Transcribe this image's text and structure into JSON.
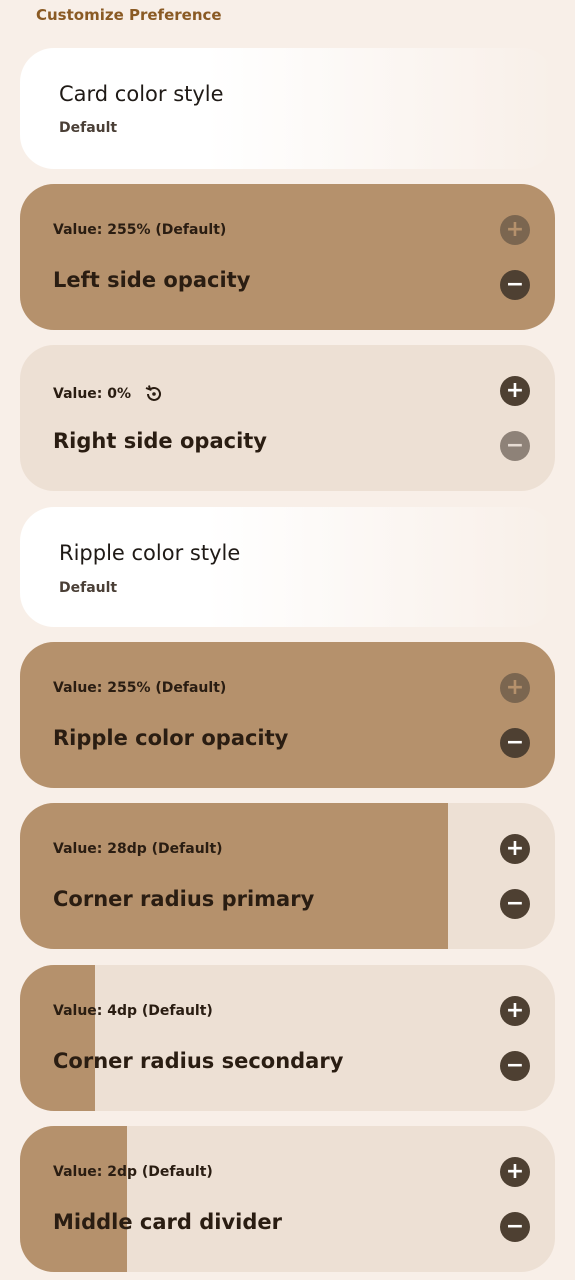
{
  "section_title": "Customize Preference",
  "card_color_style": {
    "title": "Card color style",
    "subtitle": "Default"
  },
  "left_opacity": {
    "value": "Value: 255% (Default)",
    "label": "Left side opacity",
    "fill": 1.0
  },
  "right_opacity": {
    "value": "Value: 0%",
    "label": "Right side opacity",
    "fill": 0.0,
    "reset_icon": "reset-icon"
  },
  "ripple_color_style": {
    "title": "Ripple color style",
    "subtitle": "Default"
  },
  "ripple_opacity": {
    "value": "Value: 255% (Default)",
    "label": "Ripple color opacity",
    "fill": 1.0
  },
  "corner_primary": {
    "value": "Value: 28dp (Default)",
    "label": "Corner radius primary",
    "fill": 0.8
  },
  "corner_secondary": {
    "value": "Value: 4dp (Default)",
    "label": "Corner radius secondary",
    "fill": 0.14
  },
  "middle_divider": {
    "value": "Value: 2dp (Default)",
    "label": "Middle card divider",
    "fill": 0.2
  },
  "icons": {
    "plus": "plus-icon",
    "minus": "minus-icon"
  },
  "colors": {
    "background": "#f8efe8",
    "fill": "#b5916c",
    "track": "#ede0d4",
    "button": "#4e4032",
    "accent": "#8a5a24"
  }
}
